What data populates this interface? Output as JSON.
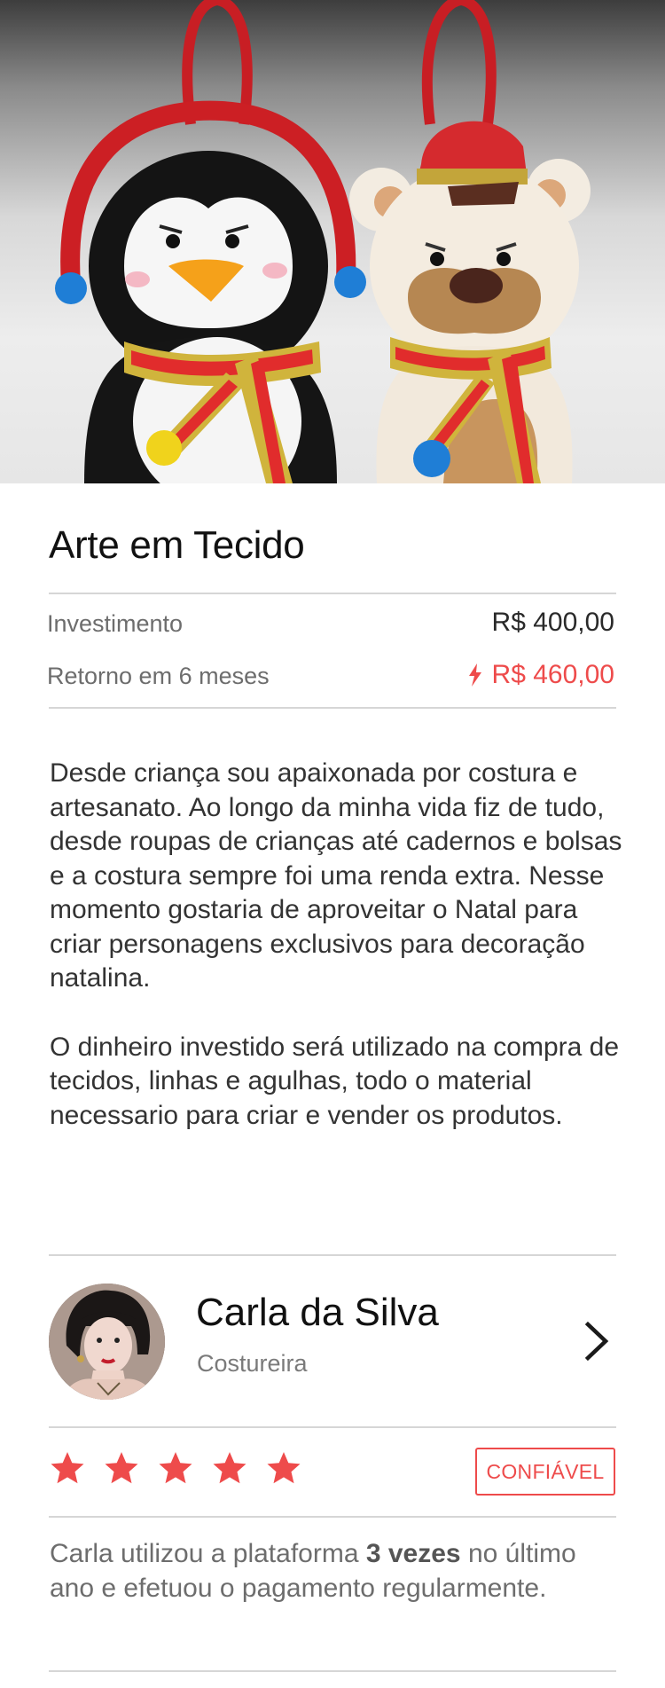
{
  "hero": {
    "icon": "felt-ornaments-photo"
  },
  "project": {
    "title": "Arte em Tecido",
    "investment_label": "Investimento",
    "investment_value": "R$ 400,00",
    "return_label": "Retorno em 6 meses",
    "return_value": "R$ 460,00",
    "return_icon": "lightning-bolt-icon"
  },
  "description": {
    "paragraph_1": "Desde criança sou apaixonada por costura e artesanato. Ao longo da minha vida fiz de tudo, desde roupas de crianças até cadernos e bolsas e a costura sempre foi uma renda extra. Nesse momento gostaria de aproveitar o Natal para criar personagens exclusivos para decoração natalina.",
    "paragraph_2": "O dinheiro investido será utilizado na compra de tecidos, linhas e agulhas, todo o material necessario para criar e vender os produtos."
  },
  "owner": {
    "name": "Carla da Silva",
    "role": "Costureira",
    "avatar_icon": "avatar-photo",
    "action_icon": "chevron-right-icon"
  },
  "rating": {
    "stars": 5,
    "max_stars": 5,
    "badge_label": "CONFIÁVEL"
  },
  "usage": {
    "prefix": "Carla utilizou a plataforma ",
    "highlight": "3 vezes",
    "suffix": " no último ano e efetuou o pagamento regularmente."
  },
  "colors": {
    "accent": "#ee4b4b",
    "text_primary": "#111111",
    "text_secondary": "#6d6d6d",
    "divider": "#d6d6d6"
  }
}
